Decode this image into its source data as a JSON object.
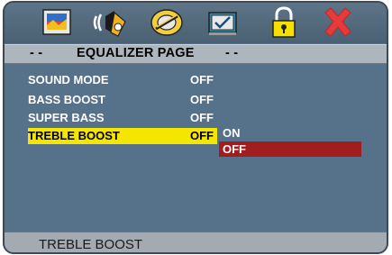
{
  "toolbar": {
    "icons": [
      "picture-icon",
      "audio-icon",
      "film-icon",
      "preference-icon",
      "lock-icon",
      "exit-icon"
    ],
    "colors": {
      "exit": "#e53b3b",
      "lock": "#f5e000"
    }
  },
  "title": {
    "left_dashes": "- -",
    "text": "EQUALIZER PAGE",
    "right_dashes": "- -"
  },
  "menu": {
    "items": [
      {
        "label": "SOUND MODE",
        "value": "OFF"
      },
      {
        "label": "BASS BOOST",
        "value": "OFF"
      },
      {
        "label": "SUPER BASS",
        "value": "OFF"
      },
      {
        "label": "TREBLE BOOST",
        "value": "OFF"
      }
    ],
    "selected_index": 3,
    "highlight_color": "#f5e600"
  },
  "options": {
    "items": [
      "ON",
      "OFF"
    ],
    "selected": "OFF",
    "selected_color": "#a21d1d"
  },
  "footer": {
    "hint": "TREBLE BOOST"
  }
}
